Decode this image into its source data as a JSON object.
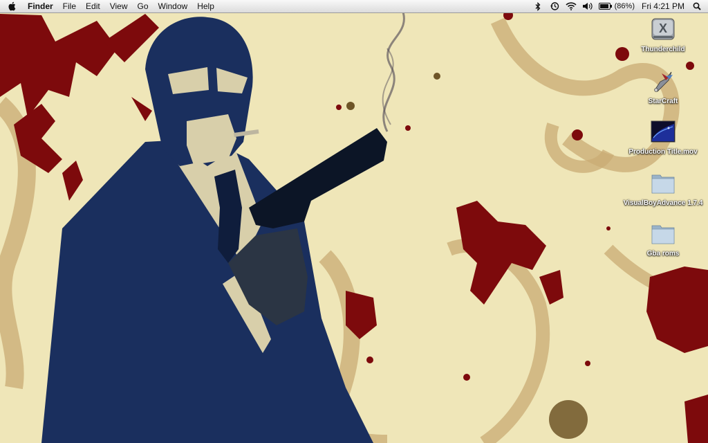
{
  "menubar": {
    "apple_icon": "apple-icon",
    "app_name": "Finder",
    "menus": [
      "File",
      "Edit",
      "View",
      "Go",
      "Window",
      "Help"
    ],
    "status": {
      "icons": [
        "bluetooth-icon",
        "time-machine-icon",
        "wifi-icon",
        "volume-icon",
        "battery-icon"
      ],
      "battery_percent": "(86%)",
      "clock": "Fri 4:21 PM",
      "spotlight_icon": "spotlight-search-icon"
    }
  },
  "desktop": {
    "wallpaper": {
      "background": "#efe6b8",
      "figure_color": "#1a2f5e",
      "face_color": "#d8cfaa",
      "splatter_color": "#7d0a0c",
      "stain_color": "#c9ab74"
    },
    "icons": [
      {
        "name": "Thunderchild",
        "kind": "drive-icon"
      },
      {
        "name": "StarCraft",
        "kind": "application-icon"
      },
      {
        "name": "Production Title.mov",
        "kind": "movie-file-icon"
      },
      {
        "name": "VisualBoyAdvance 1.7.4",
        "kind": "folder-icon"
      },
      {
        "name": "Gba roms",
        "kind": "folder-icon"
      }
    ]
  }
}
